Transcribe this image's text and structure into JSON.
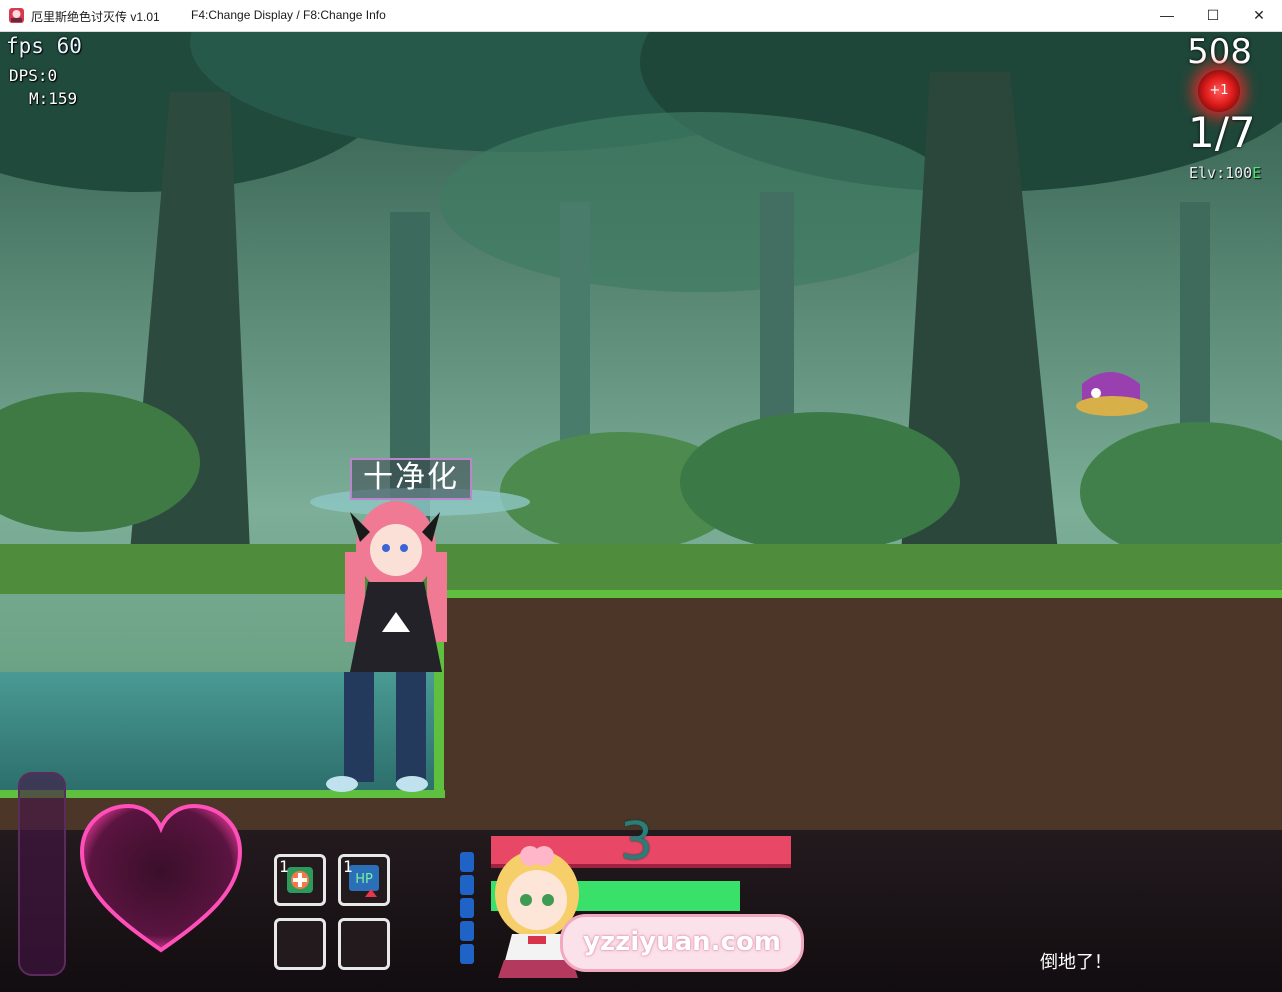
{
  "window": {
    "title": "厄里斯绝色讨灭传 v1.01",
    "hint": "F4:Change Display / F8:Change Info",
    "min_icon": "minimize-icon",
    "max_icon": "maximize-icon",
    "close_icon": "close-icon"
  },
  "hud": {
    "fps": "fps 60",
    "dps": "DPS:0",
    "m": "M:159",
    "score": "508",
    "plus_badge": "+1",
    "wave": "1/7",
    "elv_prefix": "Elv:100",
    "elv_suffix": "E"
  },
  "scene": {
    "skill_label": "十净化",
    "colors": {
      "grass": "#5fbf3f",
      "dirt": "#4b3628",
      "water": "#3c8a86"
    }
  },
  "bottom": {
    "combo": "3",
    "hp_fraction": 0.83,
    "item_slots": [
      {
        "qty": "1",
        "icon": "heal-potion-icon"
      },
      {
        "qty": "1",
        "icon": "hp-up-icon"
      },
      {
        "qty": "",
        "icon": "empty-slot"
      },
      {
        "qty": "",
        "icon": "empty-slot"
      }
    ],
    "mana_segments": 5,
    "watermark": "yzziyuan.com",
    "status": "倒地了！"
  }
}
